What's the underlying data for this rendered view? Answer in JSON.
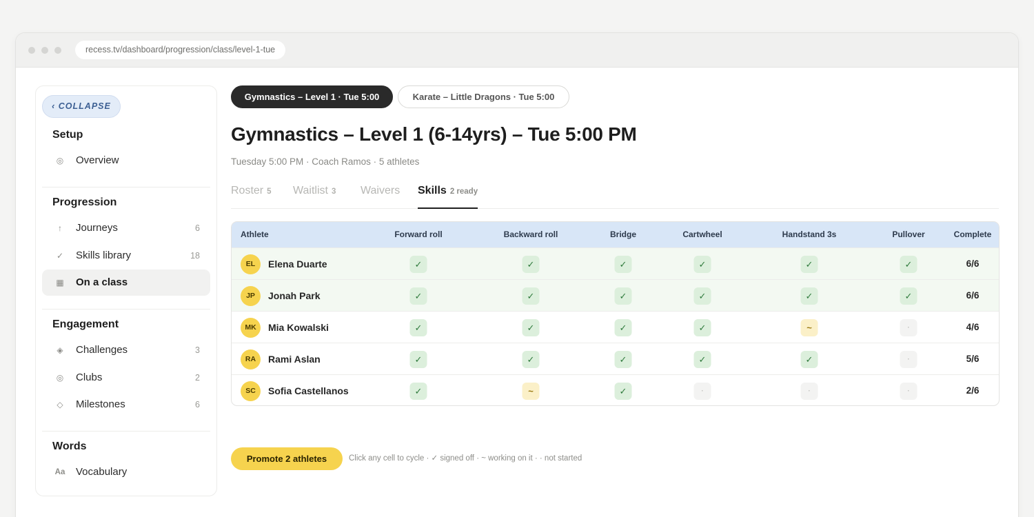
{
  "browser": {
    "url": "recess.tv/dashboard/progression/class/level-1-tue"
  },
  "sidebar": {
    "collapse_label": "‹ COLLAPSE",
    "sections": [
      {
        "title": "Setup",
        "items": [
          {
            "label": "Overview",
            "icon": "◎",
            "count": ""
          }
        ]
      },
      {
        "title": "Progression",
        "items": [
          {
            "label": "Journeys",
            "icon": "↑",
            "count": "6"
          },
          {
            "label": "Skills library",
            "icon": "✓",
            "count": "18"
          },
          {
            "label": "On a class",
            "icon": "▦",
            "count": "",
            "active": true
          }
        ]
      },
      {
        "title": "Engagement",
        "items": [
          {
            "label": "Challenges",
            "icon": "◈",
            "count": "3"
          },
          {
            "label": "Clubs",
            "icon": "◎",
            "count": "2"
          },
          {
            "label": "Milestones",
            "icon": "◇",
            "count": "6"
          }
        ]
      },
      {
        "title": "Words",
        "items": [
          {
            "label": "Vocabulary",
            "icon": "Aa",
            "count": ""
          }
        ]
      }
    ]
  },
  "class_pills": [
    {
      "label": "Gymnastics – Level 1 · Tue 5:00",
      "active": true
    },
    {
      "label": "Karate – Little Dragons · Tue 5:00",
      "active": false
    }
  ],
  "page": {
    "title": "Gymnastics – Level 1 (6-14yrs) – Tue 5:00 PM",
    "subtitle": "Tuesday 5:00 PM · Coach Ramos · 5 athletes"
  },
  "tabs": [
    {
      "label": "Roster",
      "count": "5"
    },
    {
      "label": "Waitlist",
      "count": "3"
    },
    {
      "label": "Waivers",
      "count": ""
    },
    {
      "label": "Skills",
      "count": "2 ready",
      "active": true
    }
  ],
  "table": {
    "athlete_header": "Athlete",
    "skills": [
      "Forward roll",
      "Backward roll",
      "Bridge",
      "Cartwheel",
      "Handstand 3s",
      "Pullover"
    ],
    "complete_header": "Complete",
    "status_glyphs": {
      "signed_off": "✓",
      "working": "~",
      "not_started": "·"
    },
    "rows": [
      {
        "initials": "EL",
        "name": "Elena Duarte",
        "status": [
          "signed_off",
          "signed_off",
          "signed_off",
          "signed_off",
          "signed_off",
          "signed_off"
        ],
        "complete": "6/6"
      },
      {
        "initials": "JP",
        "name": "Jonah Park",
        "status": [
          "signed_off",
          "signed_off",
          "signed_off",
          "signed_off",
          "signed_off",
          "signed_off"
        ],
        "complete": "6/6"
      },
      {
        "initials": "MK",
        "name": "Mia Kowalski",
        "status": [
          "signed_off",
          "signed_off",
          "signed_off",
          "signed_off",
          "working",
          "not_started"
        ],
        "complete": "4/6"
      },
      {
        "initials": "RA",
        "name": "Rami Aslan",
        "status": [
          "signed_off",
          "signed_off",
          "signed_off",
          "signed_off",
          "signed_off",
          "not_started"
        ],
        "complete": "5/6"
      },
      {
        "initials": "SC",
        "name": "Sofia Castellanos",
        "status": [
          "signed_off",
          "working",
          "signed_off",
          "not_started",
          "not_started",
          "not_started"
        ],
        "complete": "2/6"
      }
    ]
  },
  "footer": {
    "promote_label": "Promote 2 athletes",
    "hint": "Click any cell to cycle · ✓ signed off · ~ working on it · · not started"
  },
  "colors": {
    "accent_yellow": "#f6d34e",
    "header_blue": "#d8e6f7",
    "signed_green": "#dcefdc",
    "working_yellow": "#fbf0c8",
    "dark_pill": "#2a2a2a"
  }
}
